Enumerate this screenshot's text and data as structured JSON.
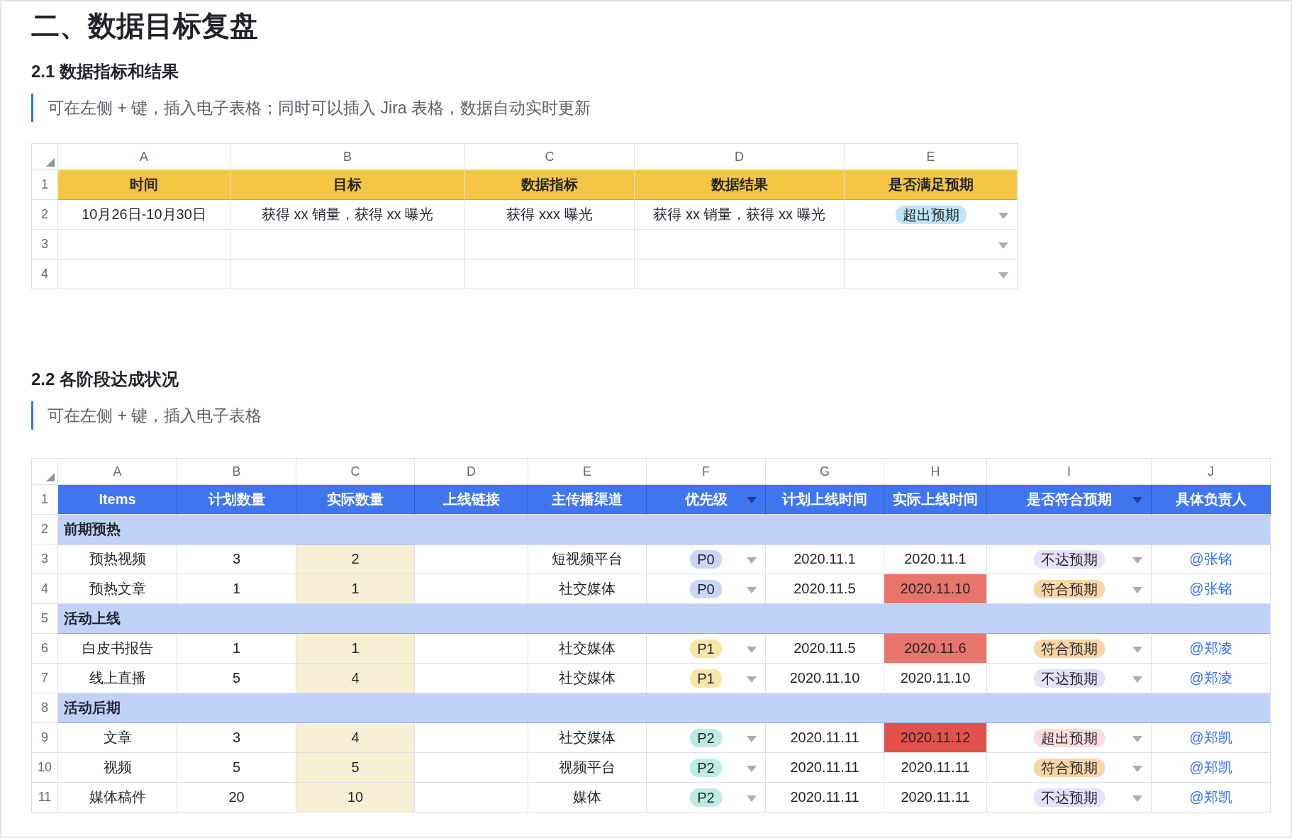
{
  "title": "二、数据目标复盘",
  "section_1": {
    "heading": "2.1 数据指标和结果",
    "note": "可在左侧 + 键，插入电子表格；同时可以插入 Jira 表格，数据自动实时更新",
    "sheet": {
      "column_letters": [
        "A",
        "B",
        "C",
        "D",
        "E"
      ],
      "header": {
        "row_number": "1",
        "labels": [
          "时间",
          "目标",
          "数据指标",
          "数据结果",
          "是否满足预期"
        ]
      },
      "rows": [
        {
          "row_number": "2",
          "time": "10月26日-10月30日",
          "target": "获得 xx 销量，获得 xx 曝光",
          "metric": "获得 xxx 曝光",
          "result": "获得 xx 销量，获得 xx 曝光",
          "status": {
            "text": "超出预期",
            "color": "#bfe3f7"
          }
        },
        {
          "row_number": "3"
        },
        {
          "row_number": "4"
        }
      ]
    }
  },
  "section_2": {
    "heading": "2.2 各阶段达成状况",
    "note": "可在左侧 + 键，插入电子表格",
    "sheet": {
      "column_letters": [
        "A",
        "B",
        "C",
        "D",
        "E",
        "F",
        "G",
        "H",
        "I",
        "J"
      ],
      "header": {
        "row_number": "1",
        "labels": [
          {
            "text": "Items",
            "filter": false
          },
          {
            "text": "计划数量",
            "filter": false
          },
          {
            "text": "实际数量",
            "filter": false
          },
          {
            "text": "上线链接",
            "filter": false
          },
          {
            "text": "主传播渠道",
            "filter": false
          },
          {
            "text": "优先级",
            "filter": true
          },
          {
            "text": "计划上线时间",
            "filter": false
          },
          {
            "text": "实际上线时间",
            "filter": false
          },
          {
            "text": "是否符合预期",
            "filter": true
          },
          {
            "text": "具体负责人",
            "filter": false
          }
        ]
      },
      "rows": [
        {
          "kind": "group",
          "row_number": "2",
          "label": "前期预热"
        },
        {
          "kind": "item",
          "row_number": "3",
          "name": "预热视频",
          "planned": "3",
          "actual": "2",
          "channel": "短视频平台",
          "priority": {
            "text": "P0",
            "color": "#c9d6f7"
          },
          "planned_date": "2020.11.1",
          "actual_date": {
            "text": "2020.11.1"
          },
          "status": {
            "text": "不达预期",
            "color": "#e6e1f8"
          },
          "owner": "@张铭"
        },
        {
          "kind": "item",
          "row_number": "4",
          "name": "预热文章",
          "planned": "1",
          "actual": "1",
          "channel": "社交媒体",
          "priority": {
            "text": "P0",
            "color": "#c9d6f7"
          },
          "planned_date": "2020.11.5",
          "actual_date": {
            "text": "2020.11.10",
            "color": "#e8756b"
          },
          "status": {
            "text": "符合预期",
            "color": "#f8d6a8"
          },
          "owner": "@张铭"
        },
        {
          "kind": "group",
          "row_number": "5",
          "label": "活动上线"
        },
        {
          "kind": "item",
          "row_number": "6",
          "name": "白皮书报告",
          "planned": "1",
          "actual": "1",
          "channel": "社交媒体",
          "priority": {
            "text": "P1",
            "color": "#f8e6a8"
          },
          "planned_date": "2020.11.5",
          "actual_date": {
            "text": "2020.11.6",
            "color": "#e8756b"
          },
          "status": {
            "text": "符合预期",
            "color": "#f8d6a8"
          },
          "owner": "@郑凌"
        },
        {
          "kind": "item",
          "row_number": "7",
          "name": "线上直播",
          "planned": "5",
          "actual": "4",
          "channel": "社交媒体",
          "priority": {
            "text": "P1",
            "color": "#f8e6a8"
          },
          "planned_date": "2020.11.10",
          "actual_date": {
            "text": "2020.11.10"
          },
          "status": {
            "text": "不达预期",
            "color": "#e6e1f8"
          },
          "owner": "@郑凌"
        },
        {
          "kind": "group",
          "row_number": "8",
          "label": "活动后期"
        },
        {
          "kind": "item",
          "row_number": "9",
          "name": "文章",
          "planned": "3",
          "actual": "4",
          "channel": "社交媒体",
          "priority": {
            "text": "P2",
            "color": "#bcece1"
          },
          "planned_date": "2020.11.11",
          "actual_date": {
            "text": "2020.11.12",
            "color": "#e0524a"
          },
          "status": {
            "text": "超出预期",
            "color": "#fbdddb"
          },
          "owner": "@郑凯"
        },
        {
          "kind": "item",
          "row_number": "10",
          "name": "视频",
          "planned": "5",
          "actual": "5",
          "channel": "视频平台",
          "priority": {
            "text": "P2",
            "color": "#bcece1"
          },
          "planned_date": "2020.11.11",
          "actual_date": {
            "text": "2020.11.11"
          },
          "status": {
            "text": "符合预期",
            "color": "#f8d6a8"
          },
          "owner": "@郑凯"
        },
        {
          "kind": "item",
          "row_number": "11",
          "name": "媒体稿件",
          "planned": "20",
          "actual": "10",
          "channel": "媒体",
          "priority": {
            "text": "P2",
            "color": "#bcece1"
          },
          "planned_date": "2020.11.11",
          "actual_date": {
            "text": "2020.11.11"
          },
          "status": {
            "text": "不达预期",
            "color": "#e6e1f8"
          },
          "owner": "@郑凯"
        }
      ]
    }
  }
}
